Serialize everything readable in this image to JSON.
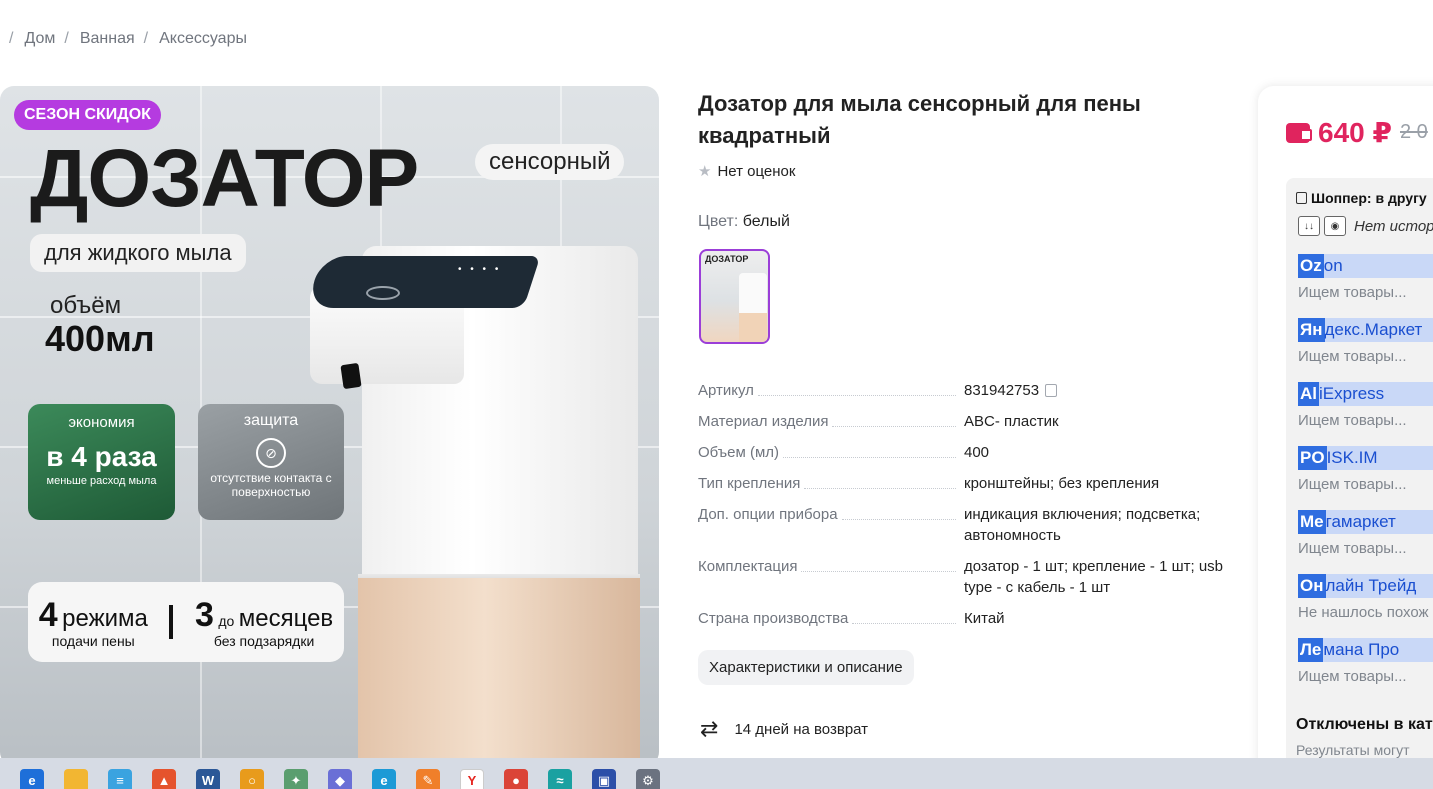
{
  "breadcrumb": [
    "Дом",
    "Ванная",
    "Аксессуары"
  ],
  "image": {
    "badge": "СЕЗОН СКИДОК",
    "headline": "ДОЗАТОР",
    "sensor_pill": "сенсорный",
    "liquid_pill": "для жидкого мыла",
    "volume_label": "объём",
    "volume_value": "400мл",
    "economy": {
      "title": "экономия",
      "value": "в 4 раза",
      "note": "меньше расход мыла"
    },
    "protection": {
      "title": "защита",
      "note": "отсутствие контакта с поверхностью"
    },
    "modes": {
      "number": "4",
      "word": "режима",
      "note": "подачи пены"
    },
    "months": {
      "number": "3",
      "prefix": "до",
      "word": "месяцев",
      "note": "без подзарядки"
    }
  },
  "product": {
    "title": "Дозатор для мыла сенсорный для пены квадратный",
    "rating": "Нет оценок",
    "color_label": "Цвет:",
    "color_value": "белый",
    "swatch_label": "ДОЗАТОР"
  },
  "specs": [
    {
      "key": "Артикул",
      "value": "831942753"
    },
    {
      "key": "Материал изделия",
      "value": "ABC- пластик"
    },
    {
      "key": "Объем (мл)",
      "value": "400"
    },
    {
      "key": "Тип крепления",
      "value": "кронштейны; без крепления"
    },
    {
      "key": "Доп. опции прибора",
      "value": "индикация включения; подсветка; автономность"
    },
    {
      "key": "Комплектация",
      "value": "дозатор - 1 шт; крепление - 1 шт; usb type - с кабель - 1 шт"
    },
    {
      "key": "Страна производства",
      "value": "Китай"
    }
  ],
  "description_button": "Характеристики и описание",
  "return_text": "14 дней на возврат",
  "price": {
    "current": "640 ₽",
    "old": "2 0"
  },
  "extension": {
    "shopper_label": "Шоппер:",
    "shopper_rest": "в другу",
    "history_text": "Нет истор",
    "stores": [
      {
        "hl": "Oz",
        "rest": "on",
        "status": "Ищем товары..."
      },
      {
        "hl": "Ян",
        "rest": "декс.Маркет",
        "status": "Ищем товары..."
      },
      {
        "hl": "Al",
        "rest": "iExpress",
        "status": "Ищем товары..."
      },
      {
        "hl": "PO",
        "rest": "ISK.IM",
        "status": "Ищем товары..."
      },
      {
        "hl": "Ме",
        "rest": "гамаркет",
        "status": "Ищем товары..."
      },
      {
        "hl": "Он",
        "rest": "лайн Трейд",
        "status": "Не нашлось похож"
      },
      {
        "hl": "Ле",
        "rest": "мана Про",
        "status": "Ищем товары..."
      }
    ],
    "disabled_title": "Отключены в кат",
    "disabled_sub": "Результаты могут"
  },
  "taskbar": [
    {
      "name": "edge-legacy-icon",
      "color": "#1e6fd9",
      "glyph": "e"
    },
    {
      "name": "file-explorer-icon",
      "color": "#f2b632",
      "glyph": ""
    },
    {
      "name": "notes-app-icon",
      "color": "#3aa3e0",
      "glyph": "≡"
    },
    {
      "name": "brave-browser-icon",
      "color": "#e5532d",
      "glyph": "▲"
    },
    {
      "name": "word-icon",
      "color": "#2b5797",
      "glyph": "W"
    },
    {
      "name": "search-tool-icon",
      "color": "#e89b1c",
      "glyph": "○"
    },
    {
      "name": "bird-app-icon",
      "color": "#5a9e6f",
      "glyph": "✦"
    },
    {
      "name": "vpn-shield-icon",
      "color": "#6a6fd6",
      "glyph": "◆"
    },
    {
      "name": "edge-icon",
      "color": "#1c9ad6",
      "glyph": "e"
    },
    {
      "name": "sticky-notes-icon",
      "color": "#f07f2a",
      "glyph": "✎"
    },
    {
      "name": "yandex-browser-icon",
      "color": "#ffffff",
      "glyph": "Y"
    },
    {
      "name": "chrome-icon",
      "color": "#db4437",
      "glyph": "●"
    },
    {
      "name": "wave-app-icon",
      "color": "#1aa1a1",
      "glyph": "≈"
    },
    {
      "name": "save-disk-icon",
      "color": "#2c4fa8",
      "glyph": "▣"
    },
    {
      "name": "settings-gear-icon",
      "color": "#6b7280",
      "glyph": "⚙"
    }
  ]
}
